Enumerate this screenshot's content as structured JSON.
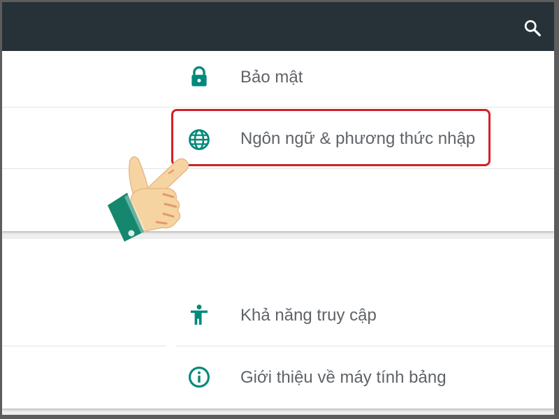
{
  "appbar": {
    "background": "#263238",
    "search_icon": "search-icon"
  },
  "settings": {
    "accent": "#00897B",
    "items": [
      {
        "label": "Bảo mật",
        "icon": "lock-icon"
      },
      {
        "label": "Ngôn ngữ & phương thức nhập",
        "icon": "globe-icon",
        "highlighted": true
      },
      {
        "label": "Khả năng truy cập",
        "icon": "accessibility-icon"
      },
      {
        "label": "Giới thiệu về máy tính bảng",
        "icon": "info-icon"
      }
    ]
  },
  "annotation": {
    "highlight_color": "#d32027",
    "pointer": "pointing-hand-icon"
  }
}
